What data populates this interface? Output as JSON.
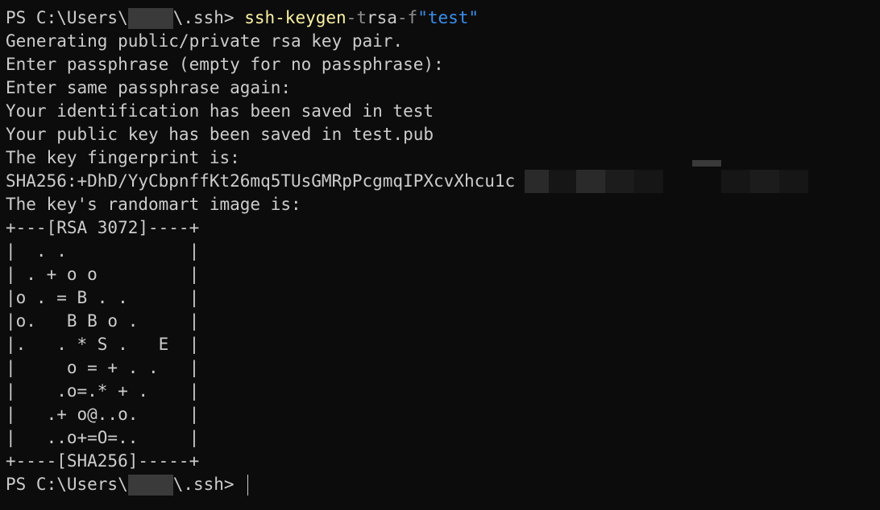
{
  "prompt": {
    "prefix": "PS C:\\Users\\",
    "suffix": "\\.ssh> "
  },
  "command": {
    "exe": "ssh-keygen",
    "flag_t": "-t",
    "type": "rsa",
    "flag_f": "-f",
    "file": "\"test\""
  },
  "output": {
    "l1": "Generating public/private rsa key pair.",
    "l2": "Enter passphrase (empty for no passphrase):",
    "l3": "Enter same passphrase again:",
    "l4": "Your identification has been saved in test",
    "l5": "Your public key has been saved in test.pub",
    "l6": "The key fingerprint is:",
    "l7": "SHA256:+DhD/YyCbpnffKt26mq5TUsGMRpPcgmqIPXcvXhcu1c",
    "l8": "The key's randomart image is:"
  },
  "randomart": [
    "+---[RSA 3072]----+",
    "|  . .            |",
    "| . + o o         |",
    "|o . = B . .      |",
    "|o.   B B o .     |",
    "|.   . * S .   E  |",
    "|     o = + . .   |",
    "|    .o=.* + .    |",
    "|   .+ o@..o.     |",
    "|   ..o+=O=..     |",
    "+----[SHA256]-----+"
  ],
  "colors": {
    "background": "#0c0c0c",
    "text": "#cccccc",
    "command": "#f9f1a5",
    "flag": "#8e8e8e",
    "string": "#3b8eea"
  }
}
